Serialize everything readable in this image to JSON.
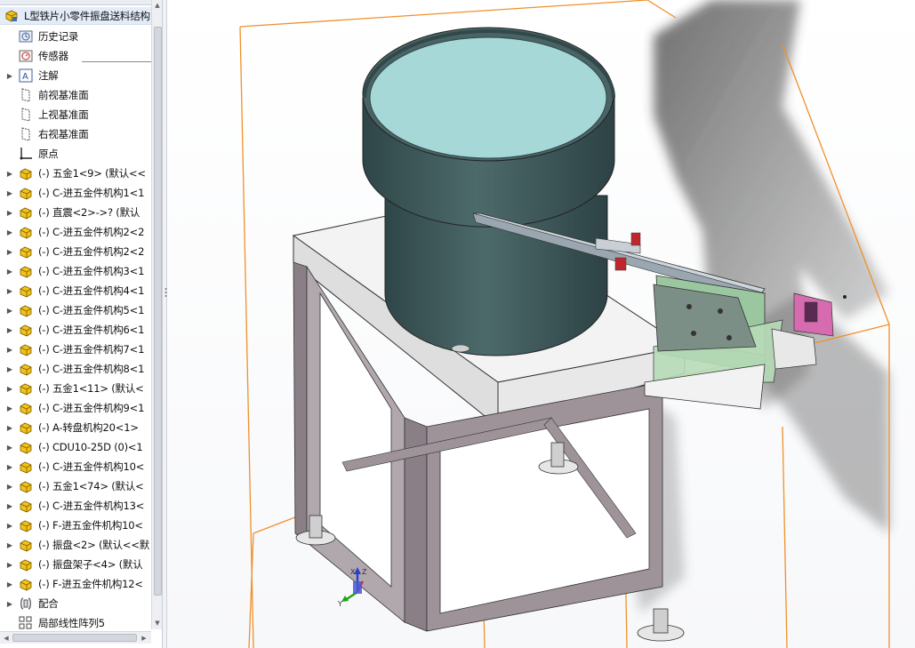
{
  "tree": {
    "root": "L型铁片小零件振盘送料结构",
    "items": [
      {
        "label": "历史记录",
        "icon": "history-icon",
        "expand": false
      },
      {
        "label": "传感器",
        "icon": "sensor-icon",
        "expand": false
      },
      {
        "label": "注解",
        "icon": "annotation-icon",
        "expand": true
      },
      {
        "label": "前视基准面",
        "icon": "plane-icon",
        "expand": false
      },
      {
        "label": "上视基准面",
        "icon": "plane-icon",
        "expand": false
      },
      {
        "label": "右视基准面",
        "icon": "plane-icon",
        "expand": false
      },
      {
        "label": "原点",
        "icon": "origin-icon",
        "expand": false
      },
      {
        "label": "(-) 五金1<9> (默认<<",
        "icon": "part-icon",
        "expand": true
      },
      {
        "label": "(-) C-进五金件机构1<1",
        "icon": "part-icon",
        "expand": true
      },
      {
        "label": "(-) 直震<2>->? (默认",
        "icon": "part-icon",
        "expand": true
      },
      {
        "label": "(-) C-进五金件机构2<2",
        "icon": "part-icon",
        "expand": true
      },
      {
        "label": "(-) C-进五金件机构2<2",
        "icon": "part-icon",
        "expand": true
      },
      {
        "label": "(-) C-进五金件机构3<1",
        "icon": "part-icon",
        "expand": true
      },
      {
        "label": "(-) C-进五金件机构4<1",
        "icon": "part-icon",
        "expand": true
      },
      {
        "label": "(-) C-进五金件机构5<1",
        "icon": "part-icon",
        "expand": true
      },
      {
        "label": "(-) C-进五金件机构6<1",
        "icon": "part-icon",
        "expand": true
      },
      {
        "label": "(-) C-进五金件机构7<1",
        "icon": "part-icon",
        "expand": true
      },
      {
        "label": "(-) C-进五金件机构8<1",
        "icon": "part-icon",
        "expand": true
      },
      {
        "label": "(-) 五金1<11> (默认<",
        "icon": "part-icon",
        "expand": true
      },
      {
        "label": "(-) C-进五金件机构9<1",
        "icon": "part-icon",
        "expand": true
      },
      {
        "label": "(-) A-转盘机构20<1>",
        "icon": "part-icon",
        "expand": true
      },
      {
        "label": "(-) CDU10-25D (0)<1",
        "icon": "part-icon",
        "expand": true
      },
      {
        "label": "(-) C-进五金件机构10<",
        "icon": "part-icon",
        "expand": true
      },
      {
        "label": "(-) 五金1<74> (默认<",
        "icon": "part-icon",
        "expand": true
      },
      {
        "label": "(-) C-进五金件机构13<",
        "icon": "part-icon",
        "expand": true
      },
      {
        "label": "(-) F-进五金件机构10<",
        "icon": "part-icon",
        "expand": true
      },
      {
        "label": "(-) 振盘<2> (默认<<默",
        "icon": "part-icon",
        "expand": true
      },
      {
        "label": "(-) 振盘架子<4> (默认",
        "icon": "part-icon",
        "expand": true
      },
      {
        "label": "(-) F-进五金件机构12<",
        "icon": "part-icon",
        "expand": true
      },
      {
        "label": "配合",
        "icon": "mates-icon",
        "expand": true
      },
      {
        "label": "局部线性阵列5",
        "icon": "pattern-icon",
        "expand": false
      }
    ]
  },
  "triad": {
    "x": "X",
    "y": "Y",
    "z": "Z"
  },
  "colors": {
    "bounding_box": "#f0902a",
    "bowl": "#3f5a5c",
    "bowl_inner": "#a6d8d8",
    "frame": "#8a7f86",
    "table_top": "#f4f4f4",
    "part_yellow": "#f3c21a"
  }
}
